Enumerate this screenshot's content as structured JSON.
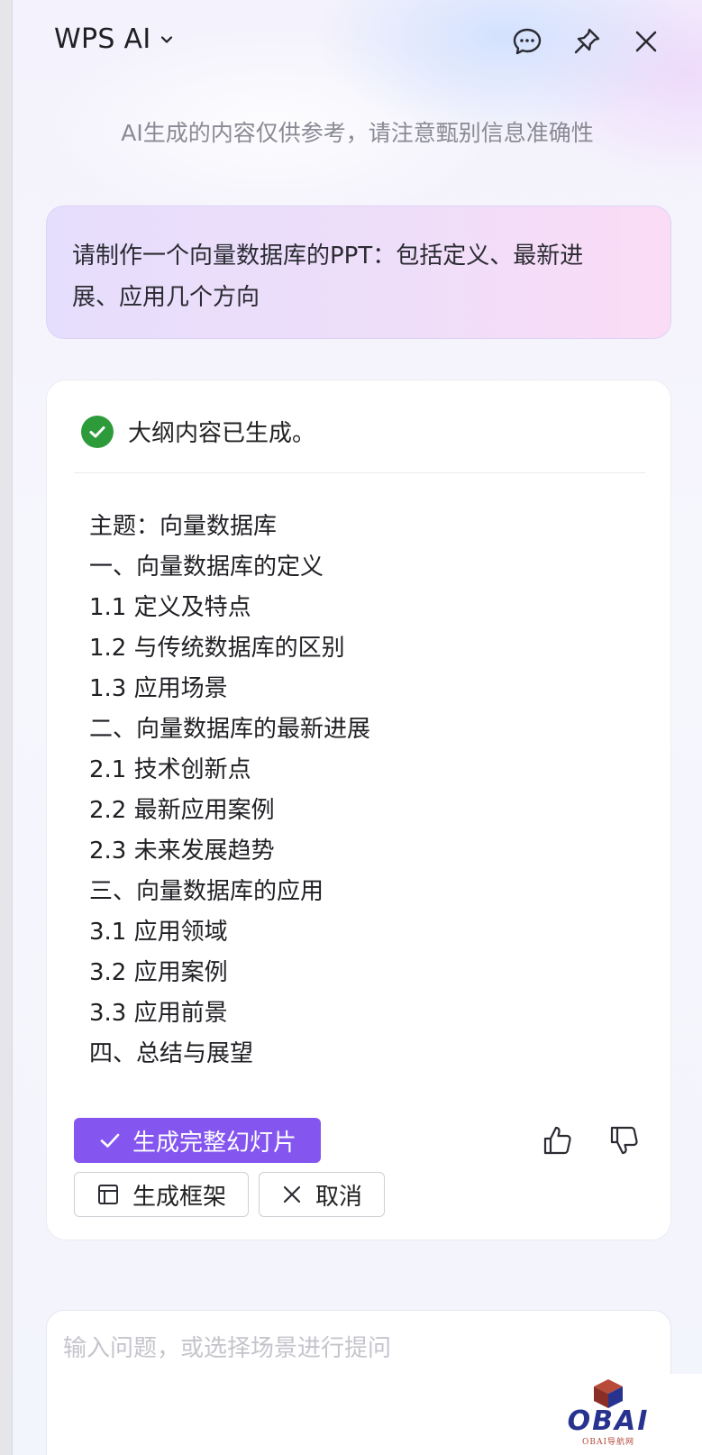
{
  "header": {
    "title": "WPS AI",
    "icons": [
      "chevron-down-icon",
      "chat-bubble-icon",
      "pin-icon",
      "close-icon"
    ]
  },
  "disclaimer": "AI生成的内容仅供参考，请注意甄别信息准确性",
  "prompt": {
    "line1": "请制作一个向量数据库的PPT：包括定义、最新进",
    "line2": "展、应用几个方向"
  },
  "result": {
    "status": "大纲内容已生成。",
    "status_icon": "check-circle-icon",
    "outline": [
      "主题：向量数据库",
      "一、向量数据库的定义",
      "1.1 定义及特点",
      "1.2 与传统数据库的区别",
      "1.3 应用场景",
      "二、向量数据库的最新进展",
      "2.1 技术创新点",
      "2.2 最新应用案例",
      "2.3 未来发展趋势",
      "三、向量数据库的应用",
      "3.1 应用领域",
      "3.2 应用案例",
      "3.3 应用前景",
      "四、总结与展望"
    ],
    "actions": {
      "generate_full": "生成完整幻灯片",
      "generate_frame": "生成框架",
      "cancel": "取消"
    },
    "feedback_icons": [
      "thumbs-up-icon",
      "thumbs-down-icon"
    ]
  },
  "input": {
    "placeholder": "输入问题，或选择场景进行提问"
  },
  "watermark": {
    "text": "OBAI",
    "subtext": "OBAI导航网"
  },
  "colors": {
    "primary": "#8456ef",
    "success": "#2e9b3a",
    "prompt_gradient_start": "#e6defd",
    "prompt_gradient_end": "#fbdcf6"
  }
}
